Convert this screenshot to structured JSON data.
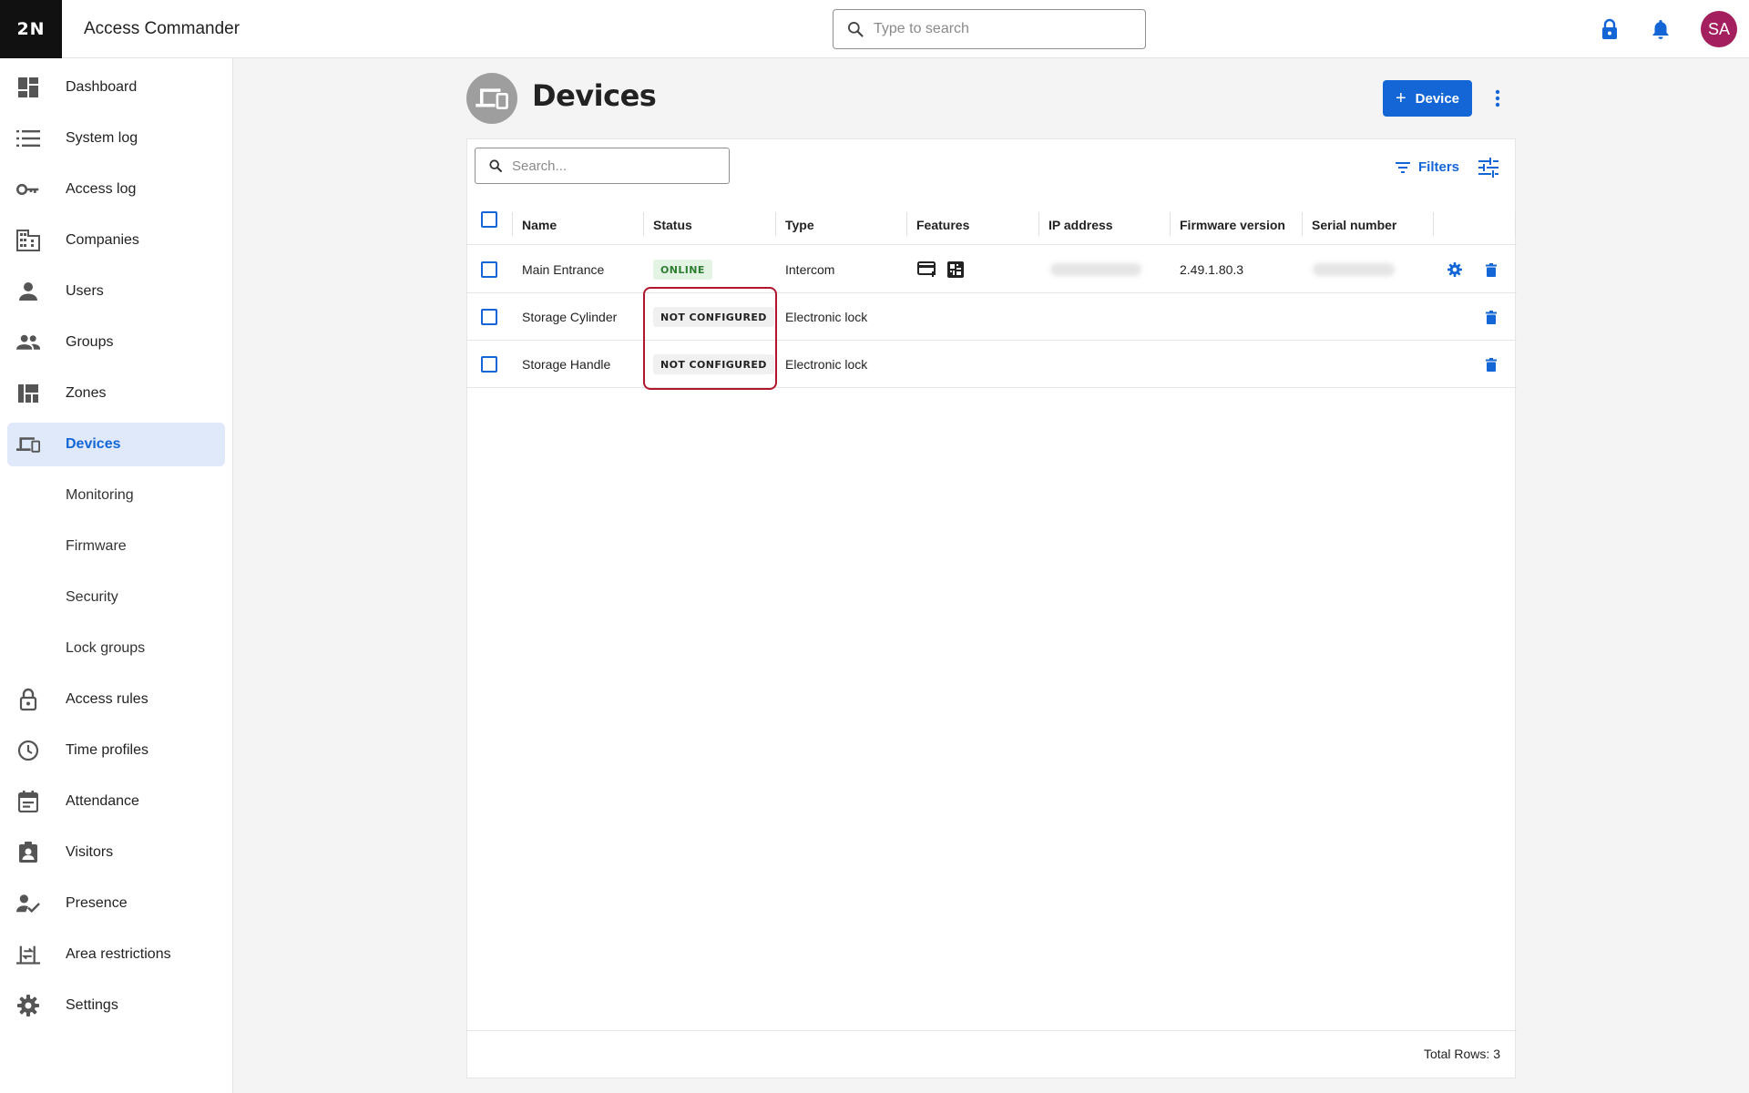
{
  "app": {
    "logo": "2N",
    "title": "Access Commander",
    "search_placeholder": "Type to search",
    "avatar_initials": "SA"
  },
  "sidebar": {
    "items": [
      {
        "label": "Dashboard",
        "icon": "dashboard-icon"
      },
      {
        "label": "System log",
        "icon": "list-icon"
      },
      {
        "label": "Access log",
        "icon": "key-icon"
      },
      {
        "label": "Companies",
        "icon": "building-icon"
      },
      {
        "label": "Users",
        "icon": "user-icon"
      },
      {
        "label": "Groups",
        "icon": "group-icon"
      },
      {
        "label": "Zones",
        "icon": "zones-icon"
      },
      {
        "label": "Devices",
        "icon": "devices-icon",
        "active": true
      },
      {
        "label": "Monitoring"
      },
      {
        "label": "Firmware"
      },
      {
        "label": "Security"
      },
      {
        "label": "Lock groups"
      },
      {
        "label": "Access rules",
        "icon": "lock-icon"
      },
      {
        "label": "Time profiles",
        "icon": "clock-icon"
      },
      {
        "label": "Attendance",
        "icon": "calendar-icon"
      },
      {
        "label": "Visitors",
        "icon": "visitor-badge-icon"
      },
      {
        "label": "Presence",
        "icon": "presence-icon"
      },
      {
        "label": "Area restrictions",
        "icon": "area-restrictions-icon"
      },
      {
        "label": "Settings",
        "icon": "gear-icon"
      }
    ]
  },
  "page": {
    "title": "Devices",
    "add_button": "Device",
    "search_placeholder": "Search...",
    "filters_label": "Filters",
    "total_rows": "Total Rows: 3"
  },
  "table": {
    "columns": [
      "Name",
      "Status",
      "Type",
      "Features",
      "IP address",
      "Firmware version",
      "Serial number"
    ],
    "rows": [
      {
        "name": "Main Entrance",
        "status": "ONLINE",
        "type": "Intercom",
        "features": [
          "card-reader-icon",
          "keypad-icon"
        ],
        "ip_address": "",
        "firmware": "2.49.1.80.3",
        "serial": "",
        "actions": [
          "gear-icon",
          "trash-icon"
        ]
      },
      {
        "name": "Storage Cylinder",
        "status": "NOT CONFIGURED",
        "type": "Electronic lock",
        "features": [],
        "ip_address": "",
        "firmware": "",
        "serial": "",
        "actions": [
          "trash-icon"
        ]
      },
      {
        "name": "Storage Handle",
        "status": "NOT CONFIGURED",
        "type": "Electronic lock",
        "features": [],
        "ip_address": "",
        "firmware": "",
        "serial": "",
        "actions": [
          "trash-icon"
        ]
      }
    ]
  },
  "colors": {
    "accent": "#1466d6",
    "avatar": "#a31f5e",
    "online_bg": "#e3f4e4",
    "online_text": "#2e7d32",
    "highlight": "#b0172d"
  }
}
